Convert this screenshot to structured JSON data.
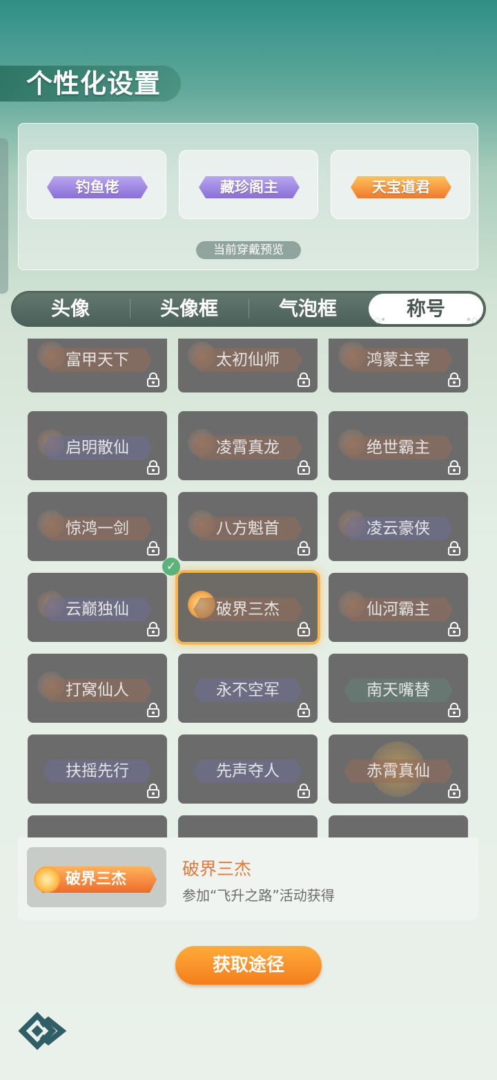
{
  "header": {
    "title": "个性化设置"
  },
  "preview": {
    "label": "当前穿戴预览",
    "items": [
      {
        "name": "钓鱼佬",
        "color": "purple"
      },
      {
        "name": "藏珍阁主",
        "color": "purple"
      },
      {
        "name": "天宝道君",
        "color": "orange"
      }
    ]
  },
  "tabs": [
    {
      "label": "头像"
    },
    {
      "label": "头像框"
    },
    {
      "label": "气泡框"
    },
    {
      "label": "称号",
      "active": true
    }
  ],
  "titles": [
    [
      "富甲天下",
      "太初仙师",
      "鸿蒙主宰"
    ],
    [
      "启明散仙",
      "凌霄真龙",
      "绝世霸主"
    ],
    [
      "惊鸿一剑",
      "八方魁首",
      "凌云豪侠"
    ],
    [
      "云巅独仙",
      "破界三杰",
      "仙河霸主"
    ],
    [
      "打窝仙人",
      "永不空军",
      "南天嘴替"
    ],
    [
      "扶摇先行",
      "先声夺人",
      "赤霄真仙"
    ],
    [
      "",
      "",
      ""
    ]
  ],
  "selected": {
    "row": 3,
    "col": 1,
    "name": "破界三杰"
  },
  "detail": {
    "badge": "破界三杰",
    "title": "破界三杰",
    "description": "参加“飞升之路”活动获得"
  },
  "button": {
    "label": "获取途径"
  },
  "colors": {
    "accent": "#f37d1c",
    "selected_glow": "#f6b64d",
    "check": "#5cb37a"
  }
}
